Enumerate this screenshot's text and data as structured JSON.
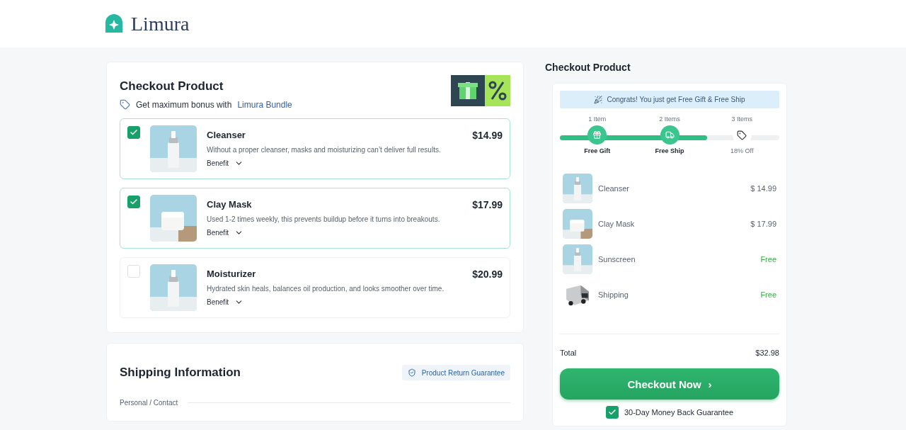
{
  "brand": {
    "name": "Limura"
  },
  "products_card": {
    "title": "Checkout Product",
    "bonus_text": "Get maximum bonus with",
    "bonus_link": "Limura Bundle",
    "products": [
      {
        "name": "Cleanser",
        "description": "Without a proper cleanser, masks and moisturizing can’t deliver full results.",
        "price": "$14.99",
        "benefit": "Benefit",
        "checked": true,
        "kind": "bottle"
      },
      {
        "name": "Clay Mask",
        "description": "Used 1-2 times weekly, this prevents buildup before it turns into breakouts.",
        "price": "$17.99",
        "benefit": "Benefit",
        "checked": true,
        "kind": "jar"
      },
      {
        "name": "Moisturizer",
        "description": "Hydrated skin heals, balances oil production, and looks smoother over time.",
        "price": "$20.99",
        "benefit": "Benefit",
        "checked": false,
        "kind": "bottle"
      }
    ]
  },
  "shipping_card": {
    "title": "Shipping Information",
    "guarantee": "Product Return Guarantee",
    "section_label": "Personal / Contact"
  },
  "summary": {
    "title": "Checkout Product",
    "banner": "Congrats! You just get Free Gift & Free Ship",
    "level": 0.67,
    "steps": [
      {
        "count": "1 Item",
        "reward": "Free Gift",
        "reached": true,
        "kind": "gift"
      },
      {
        "count": "2 Items",
        "reward": "Free Ship",
        "reached": true,
        "kind": "truck"
      },
      {
        "count": "3 Items",
        "reward": "18% Off",
        "reached": false,
        "kind": "tag"
      }
    ],
    "lines": [
      {
        "name": "Cleanser",
        "amount": "$ 14.99",
        "free": false,
        "kind": "bottle"
      },
      {
        "name": "Clay Mask",
        "amount": "$ 17.99",
        "free": false,
        "kind": "jar"
      },
      {
        "name": "Sunscreen",
        "amount": "Free",
        "free": true,
        "kind": "bottle"
      },
      {
        "name": "Shipping",
        "amount": "Free",
        "free": true,
        "kind": "truck"
      }
    ],
    "total_label": "Total",
    "total": "$32.98",
    "checkout": "Checkout Now",
    "checkout_arrow": "›",
    "guarantee": "30-Day Money Back Guarantee",
    "guarantee_checked": true
  }
}
